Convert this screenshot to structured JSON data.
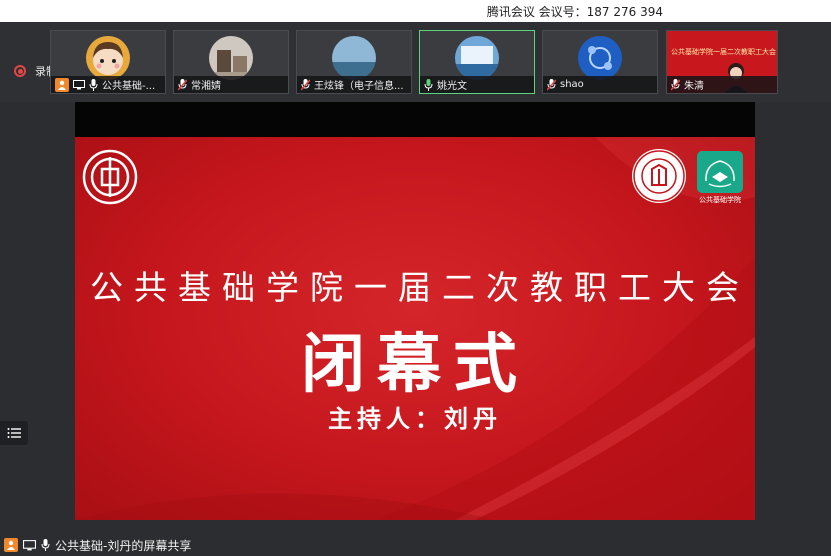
{
  "meeting": {
    "info": "腾讯会议 会议号：187 276 394"
  },
  "recording": {
    "label": "录制中"
  },
  "participants": [
    {
      "name": "公共基础-...",
      "avatar": "cartoon-girl",
      "mic": "on",
      "role": "host-sharing"
    },
    {
      "name": "常湘婧",
      "avatar": "photo-objects",
      "mic": "muted"
    },
    {
      "name": "王炫锋（电子信息...",
      "avatar": "photo-sky",
      "mic": "muted"
    },
    {
      "name": "姚光文",
      "avatar": "photo-waterfall",
      "mic": "on",
      "speaking": true
    },
    {
      "name": "shao",
      "avatar": "photo-blue-pattern",
      "mic": "muted"
    },
    {
      "name": "朱清",
      "avatar": "video-camera",
      "mic": "muted",
      "video_banner": "公共基础学院一届二次教职工大会"
    }
  ],
  "slide": {
    "title": "公共基础学院一届二次教职工大会",
    "subtitle": "闭幕式",
    "host": "主持人：刘丹",
    "logo_right2_label": "公共基础学院"
  },
  "share": {
    "label": "公共基础-刘丹的屏幕共享"
  },
  "colors": {
    "slide_red": "#c4161c",
    "accent_orange": "#f0892e",
    "speaking_green": "#5fd27e",
    "record_red": "#e34646"
  }
}
